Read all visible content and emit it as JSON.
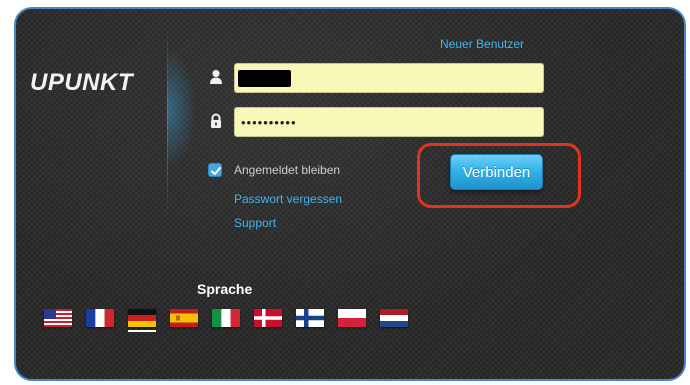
{
  "logo": {
    "text": "UPUNKT"
  },
  "header": {
    "new_user_label": "Neuer Benutzer"
  },
  "login": {
    "username_value": "",
    "password_value": "••••••••••",
    "remember_label": "Angemeldet bleiben",
    "remember_checked": true,
    "forgot_label": "Passwort vergessen",
    "support_label": "Support",
    "connect_label": "Verbinden"
  },
  "language": {
    "label": "Sprache",
    "selected": "de",
    "flags": [
      {
        "code": "us",
        "icon": "flag-us-icon"
      },
      {
        "code": "fr",
        "icon": "flag-fr-icon"
      },
      {
        "code": "de",
        "icon": "flag-de-icon"
      },
      {
        "code": "es",
        "icon": "flag-es-icon"
      },
      {
        "code": "it",
        "icon": "flag-it-icon"
      },
      {
        "code": "dk",
        "icon": "flag-dk-icon"
      },
      {
        "code": "fi",
        "icon": "flag-fi-icon"
      },
      {
        "code": "pl",
        "icon": "flag-pl-icon"
      },
      {
        "code": "nl",
        "icon": "flag-nl-icon"
      }
    ]
  },
  "colors": {
    "accent": "#3fb6ee",
    "input_bg": "#f8f8b8",
    "highlight": "#e0341e",
    "panel_border": "#4a86c8"
  }
}
